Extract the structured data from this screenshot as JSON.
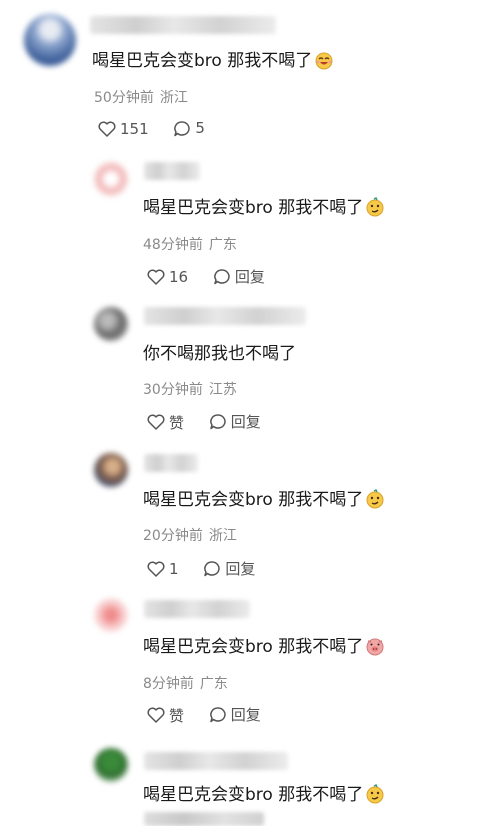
{
  "comments": [
    {
      "text": "喝星巴克会变bro 那我不喝了",
      "time": "50分钟前",
      "location": "浙江",
      "likes": "151",
      "replies": "5",
      "emoji": "laughing-face",
      "avatar_color": "#5a78b0"
    },
    {
      "text": "喝星巴克会变bro 那我不喝了",
      "time": "48分钟前",
      "location": "广东",
      "likes": "16",
      "reply_label": "回复",
      "emoji": "smirk-face",
      "avatar_color": "#e8a0a0"
    },
    {
      "text": "你不喝那我也不喝了",
      "time": "30分钟前",
      "location": "江苏",
      "likes": "赞",
      "reply_label": "回复",
      "avatar_color": "#6a6a6a"
    },
    {
      "text": "喝星巴克会变bro 那我不喝了",
      "time": "20分钟前",
      "location": "浙江",
      "likes": "1",
      "reply_label": "回复",
      "emoji": "smirk-face",
      "avatar_color": "#8a7a6a"
    },
    {
      "text": "喝星巴克会变bro 那我不喝了",
      "time": "8分钟前",
      "location": "广东",
      "likes": "赞",
      "reply_label": "回复",
      "emoji": "pig-face",
      "avatar_color": "#e07070"
    },
    {
      "text": "喝星巴克会变bro 那我不喝了",
      "emoji": "smirk-face",
      "avatar_color": "#2e6b2e"
    }
  ],
  "icons": {
    "like": "heart-outline-icon",
    "reply": "speech-bubble-icon"
  }
}
